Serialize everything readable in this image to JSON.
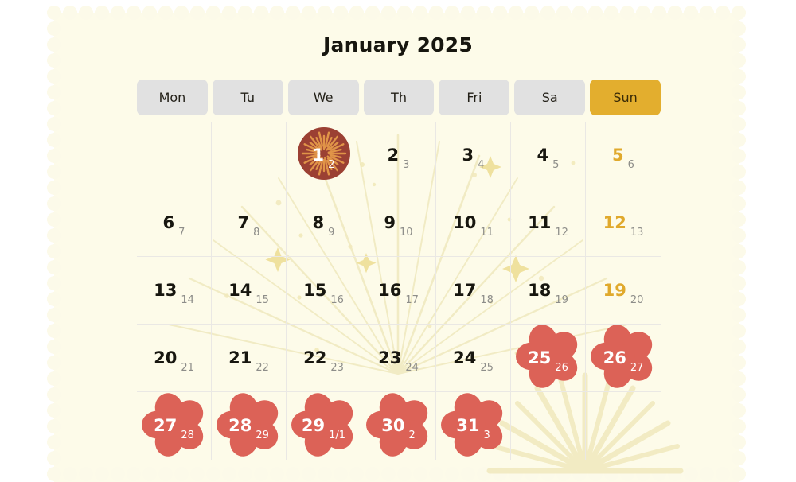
{
  "colors": {
    "page_bg": "#ffffff",
    "card_bg": "#FDFBE9",
    "weekday_pill": "#E1E1E1",
    "sunday_pill": "#E3AE2E",
    "sunday_text": "#E0A92C",
    "firework_circle": "#9B4033",
    "firework_rays": "#E09448",
    "blossom": "#DC6257",
    "grid_line": "#EAE8E4",
    "sub_num": "#8d8d89",
    "decor_ray": "#F2EDC6"
  },
  "header": {
    "title": "January 2025"
  },
  "weekdays": [
    {
      "label": "Mon",
      "highlight": false
    },
    {
      "label": "Tu",
      "highlight": false
    },
    {
      "label": "We",
      "highlight": false
    },
    {
      "label": "Th",
      "highlight": false
    },
    {
      "label": "Fri",
      "highlight": false
    },
    {
      "label": "Sa",
      "highlight": false
    },
    {
      "label": "Sun",
      "highlight": true
    }
  ],
  "calendar": {
    "weeks": [
      [
        {
          "day": "",
          "sub": "",
          "mark": "none",
          "sunday": false
        },
        {
          "day": "",
          "sub": "",
          "mark": "none",
          "sunday": false
        },
        {
          "day": "1",
          "sub": "2",
          "mark": "firework",
          "sunday": false
        },
        {
          "day": "2",
          "sub": "3",
          "mark": "none",
          "sunday": false
        },
        {
          "day": "3",
          "sub": "4",
          "mark": "none",
          "sunday": false
        },
        {
          "day": "4",
          "sub": "5",
          "mark": "none",
          "sunday": false
        },
        {
          "day": "5",
          "sub": "6",
          "mark": "none",
          "sunday": true
        }
      ],
      [
        {
          "day": "6",
          "sub": "7",
          "mark": "none",
          "sunday": false
        },
        {
          "day": "7",
          "sub": "8",
          "mark": "none",
          "sunday": false
        },
        {
          "day": "8",
          "sub": "9",
          "mark": "none",
          "sunday": false
        },
        {
          "day": "9",
          "sub": "10",
          "mark": "none",
          "sunday": false
        },
        {
          "day": "10",
          "sub": "11",
          "mark": "none",
          "sunday": false
        },
        {
          "day": "11",
          "sub": "12",
          "mark": "none",
          "sunday": false
        },
        {
          "day": "12",
          "sub": "13",
          "mark": "none",
          "sunday": true
        }
      ],
      [
        {
          "day": "13",
          "sub": "14",
          "mark": "none",
          "sunday": false
        },
        {
          "day": "14",
          "sub": "15",
          "mark": "none",
          "sunday": false
        },
        {
          "day": "15",
          "sub": "16",
          "mark": "none",
          "sunday": false
        },
        {
          "day": "16",
          "sub": "17",
          "mark": "none",
          "sunday": false
        },
        {
          "day": "17",
          "sub": "18",
          "mark": "none",
          "sunday": false
        },
        {
          "day": "18",
          "sub": "19",
          "mark": "none",
          "sunday": false
        },
        {
          "day": "19",
          "sub": "20",
          "mark": "none",
          "sunday": true
        }
      ],
      [
        {
          "day": "20",
          "sub": "21",
          "mark": "none",
          "sunday": false
        },
        {
          "day": "21",
          "sub": "22",
          "mark": "none",
          "sunday": false
        },
        {
          "day": "22",
          "sub": "23",
          "mark": "none",
          "sunday": false
        },
        {
          "day": "23",
          "sub": "24",
          "mark": "none",
          "sunday": false
        },
        {
          "day": "24",
          "sub": "25",
          "mark": "none",
          "sunday": false
        },
        {
          "day": "25",
          "sub": "26",
          "mark": "blossom",
          "sunday": false
        },
        {
          "day": "26",
          "sub": "27",
          "mark": "blossom",
          "sunday": true
        }
      ],
      [
        {
          "day": "27",
          "sub": "28",
          "mark": "blossom",
          "sunday": false
        },
        {
          "day": "28",
          "sub": "29",
          "mark": "blossom",
          "sunday": false
        },
        {
          "day": "29",
          "sub": "1/1",
          "mark": "blossom",
          "sunday": false
        },
        {
          "day": "30",
          "sub": "2",
          "mark": "blossom",
          "sunday": false
        },
        {
          "day": "31",
          "sub": "3",
          "mark": "blossom",
          "sunday": false
        },
        {
          "day": "",
          "sub": "",
          "mark": "none",
          "sunday": false
        },
        {
          "day": "",
          "sub": "",
          "mark": "none",
          "sunday": true
        }
      ]
    ]
  }
}
